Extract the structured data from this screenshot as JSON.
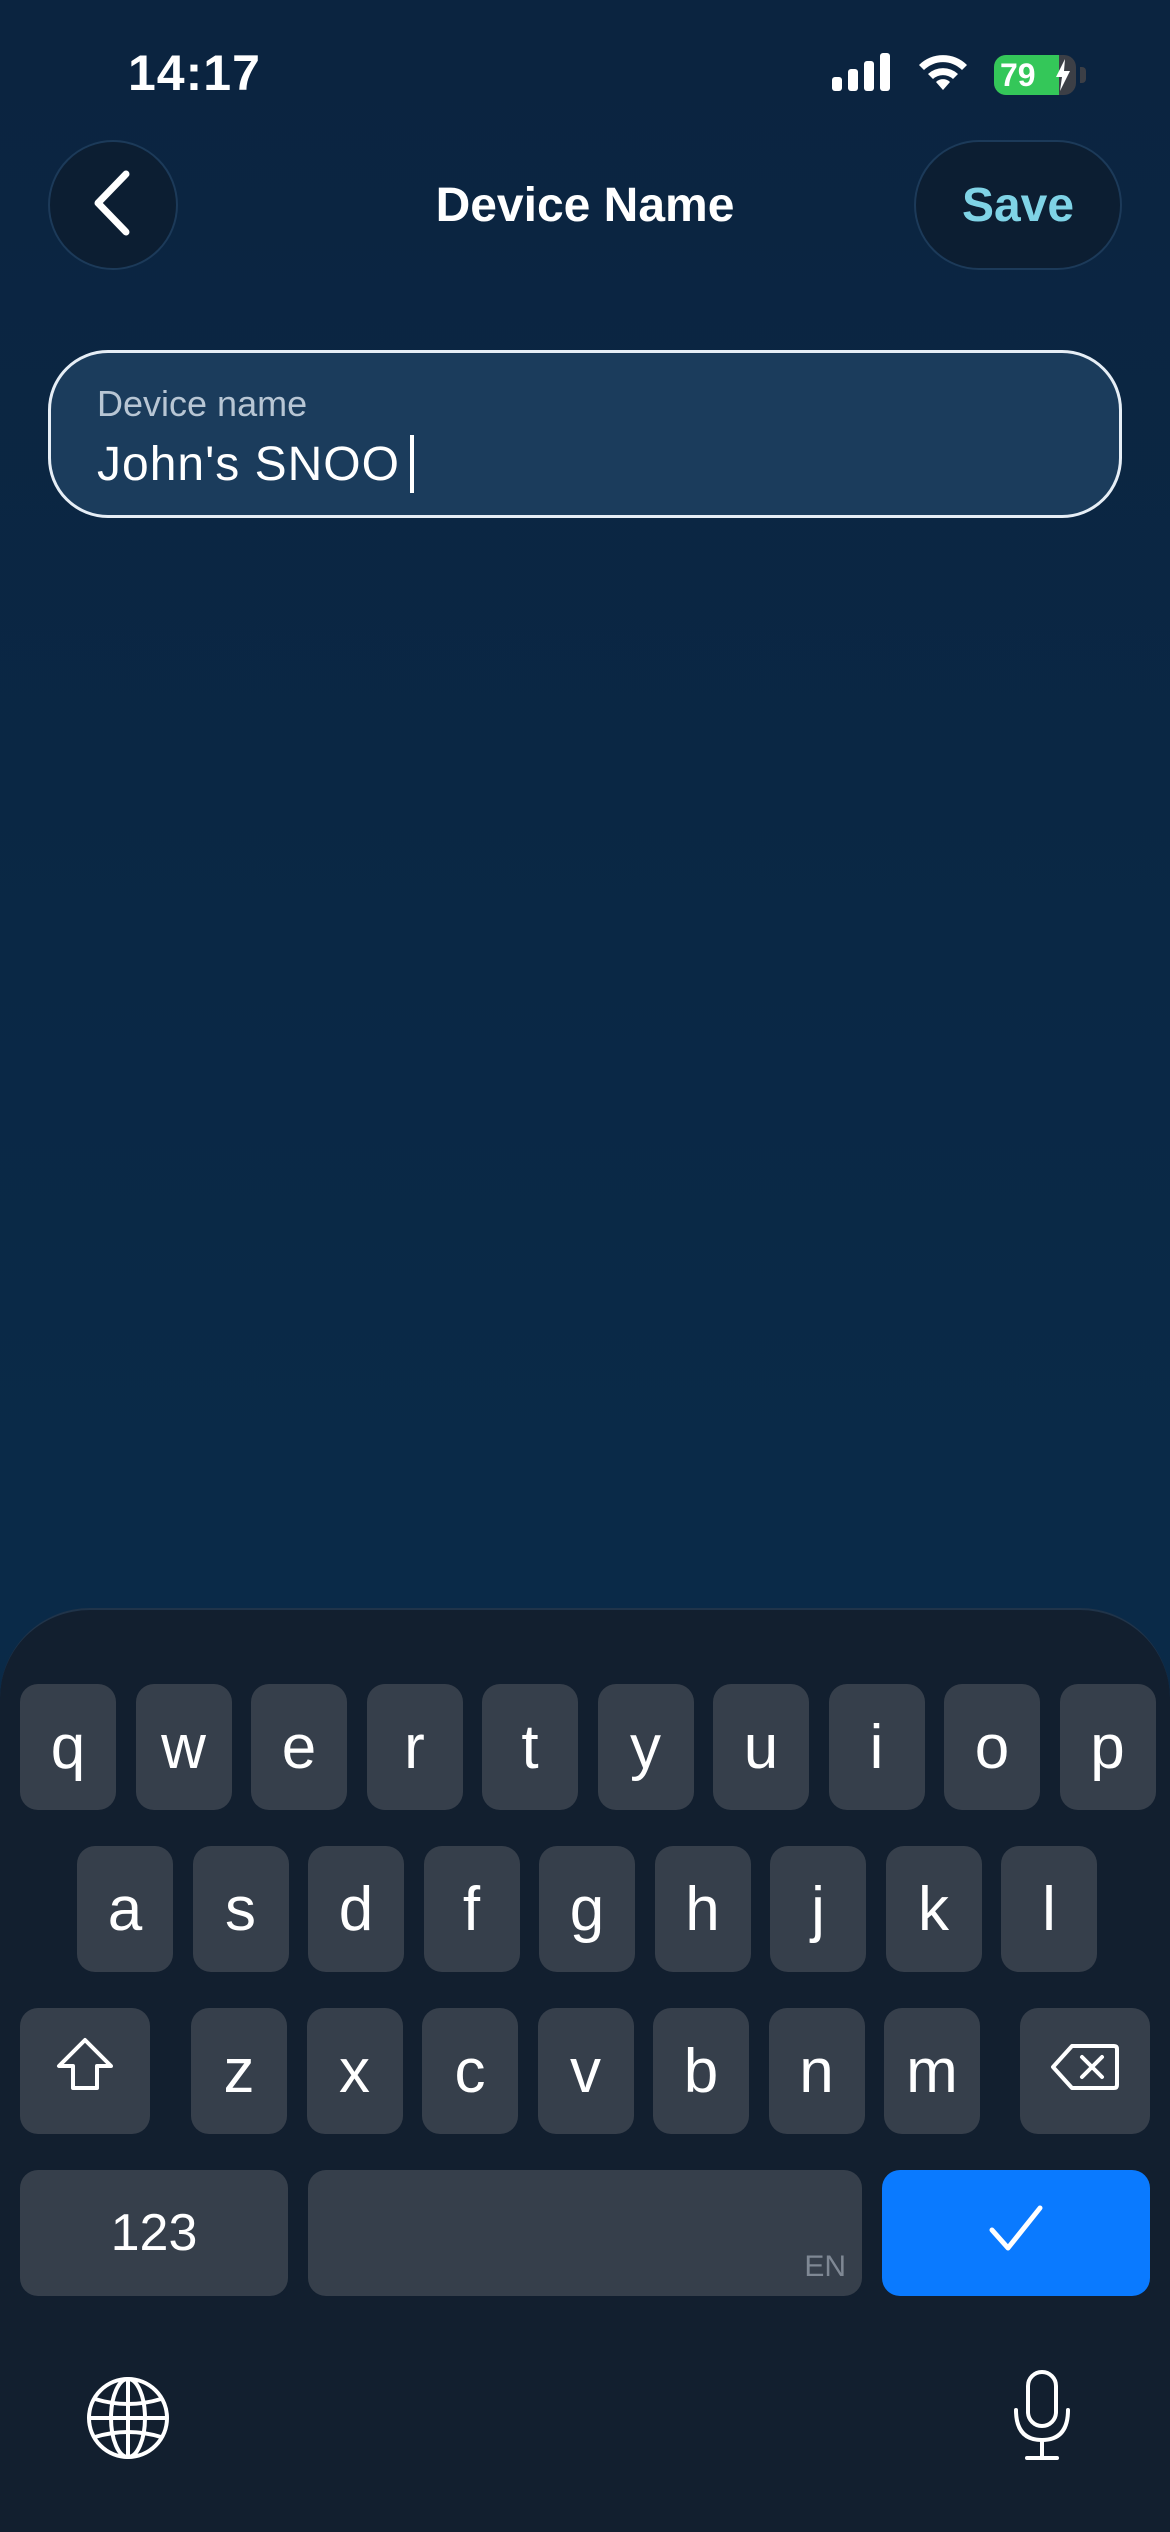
{
  "status_bar": {
    "time": "14:17",
    "battery_percent_label": "79",
    "battery_level": 0.79,
    "icons": [
      "signal-icon",
      "wifi-icon",
      "battery-icon",
      "charging-bolt-icon"
    ]
  },
  "header": {
    "title": "Device Name",
    "back_icon": "chevron-left-icon",
    "save_label": "Save"
  },
  "form": {
    "field_label": "Device name",
    "field_value": "John's SNOO"
  },
  "keyboard": {
    "row1": [
      "q",
      "w",
      "e",
      "r",
      "t",
      "y",
      "u",
      "i",
      "o",
      "p"
    ],
    "row2": [
      "a",
      "s",
      "d",
      "f",
      "g",
      "h",
      "j",
      "k",
      "l"
    ],
    "row3": [
      "z",
      "x",
      "c",
      "v",
      "b",
      "n",
      "m"
    ],
    "numbers_label": "123",
    "space_lang_label": "EN",
    "icons": [
      "shift-icon",
      "delete-icon",
      "checkmark-icon",
      "globe-icon",
      "microphone-icon"
    ]
  },
  "colors": {
    "background": "#0b2540",
    "accent_text": "#7fd3e6",
    "keyboard_bg": "#121f2f",
    "key_bg": "#363f4b",
    "confirm_key": "#0a7aff",
    "battery_green": "#34c759"
  }
}
